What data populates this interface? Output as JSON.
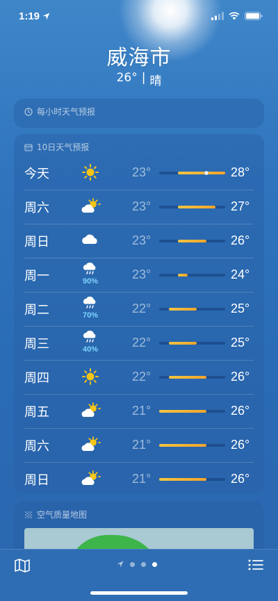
{
  "status_bar": {
    "time": "1:19"
  },
  "header": {
    "city": "威海市",
    "temp": "26°",
    "separator": "|",
    "condition": "晴"
  },
  "hourly": {
    "title": "每小时天气预报"
  },
  "forecast": {
    "title": "10日天气预报",
    "range_min": 21,
    "range_max": 28,
    "days": [
      {
        "day": "今天",
        "icon": "sun-icon",
        "precip": "",
        "low": "23°",
        "high": "28°",
        "low_val": 23,
        "high_val": 28,
        "current": 26
      },
      {
        "day": "周六",
        "icon": "partly-cloudy-icon",
        "precip": "",
        "low": "23°",
        "high": "27°",
        "low_val": 23,
        "high_val": 27
      },
      {
        "day": "周日",
        "icon": "cloud-icon",
        "precip": "",
        "low": "23°",
        "high": "26°",
        "low_val": 23,
        "high_val": 26
      },
      {
        "day": "周一",
        "icon": "rain-cloud-icon",
        "precip": "90%",
        "low": "23°",
        "high": "24°",
        "low_val": 23,
        "high_val": 24
      },
      {
        "day": "周二",
        "icon": "rain-cloud-icon",
        "precip": "70%",
        "low": "22°",
        "high": "25°",
        "low_val": 22,
        "high_val": 25
      },
      {
        "day": "周三",
        "icon": "rain-cloud-icon",
        "precip": "40%",
        "low": "22°",
        "high": "25°",
        "low_val": 22,
        "high_val": 25
      },
      {
        "day": "周四",
        "icon": "sun-icon",
        "precip": "",
        "low": "22°",
        "high": "26°",
        "low_val": 22,
        "high_val": 26
      },
      {
        "day": "周五",
        "icon": "partly-cloudy-icon",
        "precip": "",
        "low": "21°",
        "high": "26°",
        "low_val": 21,
        "high_val": 26
      },
      {
        "day": "周六",
        "icon": "partly-cloudy-icon",
        "precip": "",
        "low": "21°",
        "high": "26°",
        "low_val": 21,
        "high_val": 26
      },
      {
        "day": "周日",
        "icon": "partly-cloudy-icon",
        "precip": "",
        "low": "21°",
        "high": "26°",
        "low_val": 21,
        "high_val": 26
      }
    ]
  },
  "air_quality": {
    "title": "空气质量地图"
  },
  "bottom_bar": {
    "page_count": 3,
    "active_page": 3
  },
  "colors": {
    "background": "#2f74bd",
    "bar_warm": "#f2a52b",
    "precip": "#7fd3ff"
  }
}
